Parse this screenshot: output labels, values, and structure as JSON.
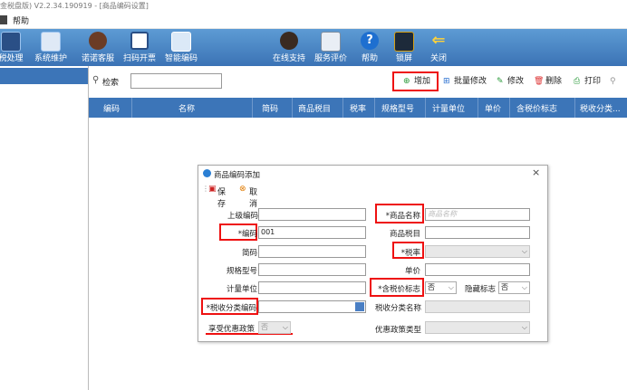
{
  "window_title": "金税盘版)  V2.2.34.190919 - [商品编码设置]",
  "menu": {
    "item1": "帮助"
  },
  "toolbar": [
    {
      "label": "税处理",
      "icon": "monitor-icon"
    },
    {
      "label": "系统维护",
      "icon": "settings-monitor-icon"
    },
    {
      "label": "诺诺客服",
      "icon": "customer-service-icon"
    },
    {
      "label": "扫码开票",
      "icon": "qrcode-icon"
    },
    {
      "label": "智能编码",
      "icon": "cloud-icon"
    },
    {
      "label": "在线支持",
      "icon": "support-person-icon"
    },
    {
      "label": "服务评价",
      "icon": "evaluation-icon"
    },
    {
      "label": "帮助",
      "icon": "help-icon"
    },
    {
      "label": "锁屏",
      "icon": "lock-screen-icon"
    },
    {
      "label": "关闭",
      "icon": "close-arrow-icon"
    }
  ],
  "search": {
    "label": "检索",
    "value": ""
  },
  "actions": {
    "add": "增加",
    "batch_edit": "批量修改",
    "edit": "修改",
    "delete": "删除",
    "print": "打印"
  },
  "grid": {
    "columns": [
      "编码",
      "名称",
      "简码",
      "商品税目",
      "税率",
      "规格型号",
      "计量单位",
      "单价",
      "含税价标志",
      "税收分类..."
    ]
  },
  "dialog": {
    "title": "商品编码添加",
    "save": "保存",
    "cancel": "取消",
    "fields": {
      "parent_code": {
        "label": "上级编码",
        "value": ""
      },
      "product_name": {
        "label": "*商品名称",
        "placeholder": "商品名称"
      },
      "code": {
        "label": "*编码",
        "value": "001"
      },
      "tax_item": {
        "label": "商品税目",
        "value": ""
      },
      "short_code": {
        "label": "简码",
        "value": ""
      },
      "tax_rate": {
        "label": "*税率",
        "value": ""
      },
      "spec": {
        "label": "规格型号",
        "value": ""
      },
      "unit_price": {
        "label": "单价",
        "value": ""
      },
      "unit": {
        "label": "计量单位",
        "value": ""
      },
      "tax_incl_flag": {
        "label": "*含税价标志",
        "value": "否"
      },
      "hidden_flag": {
        "label": "隐藏标志",
        "value": "否"
      },
      "tax_class_code": {
        "label": "*税收分类编码",
        "value": ""
      },
      "tax_class_name": {
        "label": "税收分类名称",
        "value": ""
      },
      "preferential": {
        "label": "享受优惠政策",
        "value": "否"
      },
      "preferential_type": {
        "label": "优惠政策类型",
        "value": ""
      }
    }
  },
  "colors": {
    "toolbar": "#3b73b5",
    "grid_header": "#3c75b8",
    "highlight": "#e11111"
  }
}
